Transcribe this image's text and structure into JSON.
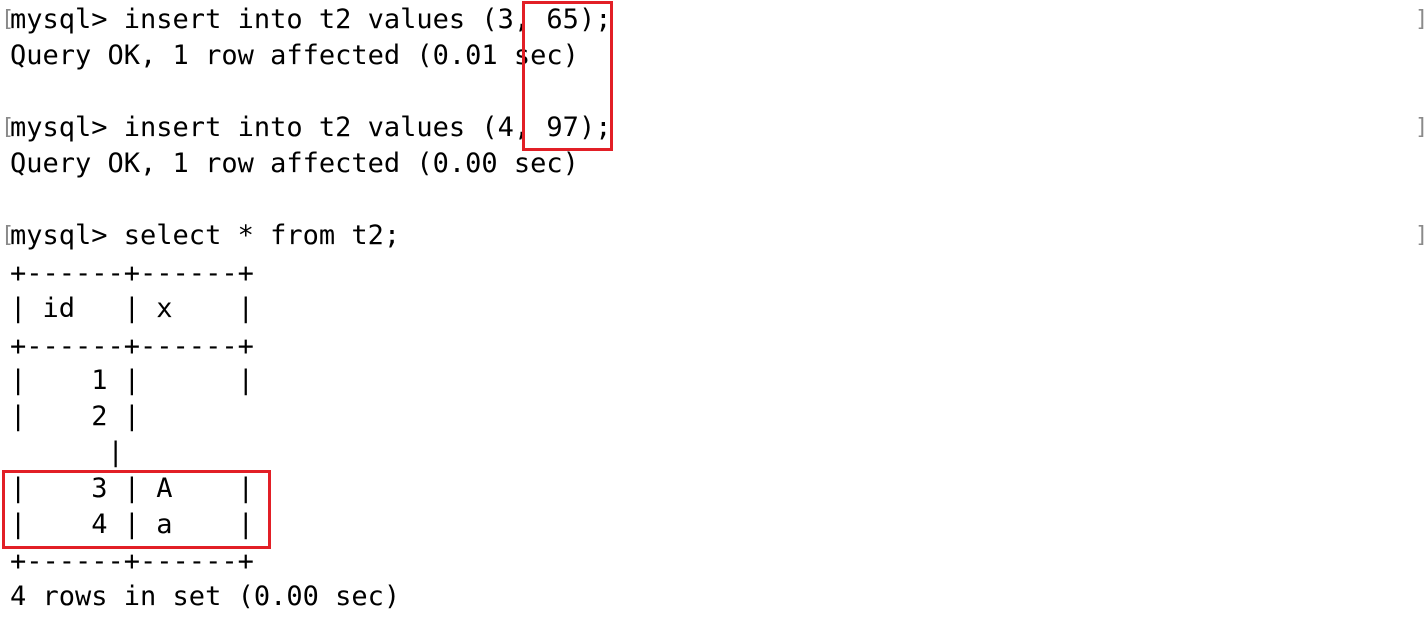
{
  "terminal": {
    "prompt_bracket_open": "[",
    "prompt_bracket_close": "]",
    "lines": [
      "mysql> insert into t2 values (3, 65);",
      "Query OK, 1 row affected (0.01 sec)",
      "",
      "mysql> insert into t2 values (4, 97);",
      "Query OK, 1 row affected (0.00 sec)",
      "",
      "mysql> select * from t2;",
      "+------+------+",
      "| id   | x    |",
      "+------+------+",
      "|    1 |      |",
      "|    2 |",
      "      |",
      "|    3 | A    |",
      "|    4 | a    |",
      "+------+------+",
      "4 rows in set (0.00 sec)"
    ]
  },
  "highlight_color": "#e21f26"
}
